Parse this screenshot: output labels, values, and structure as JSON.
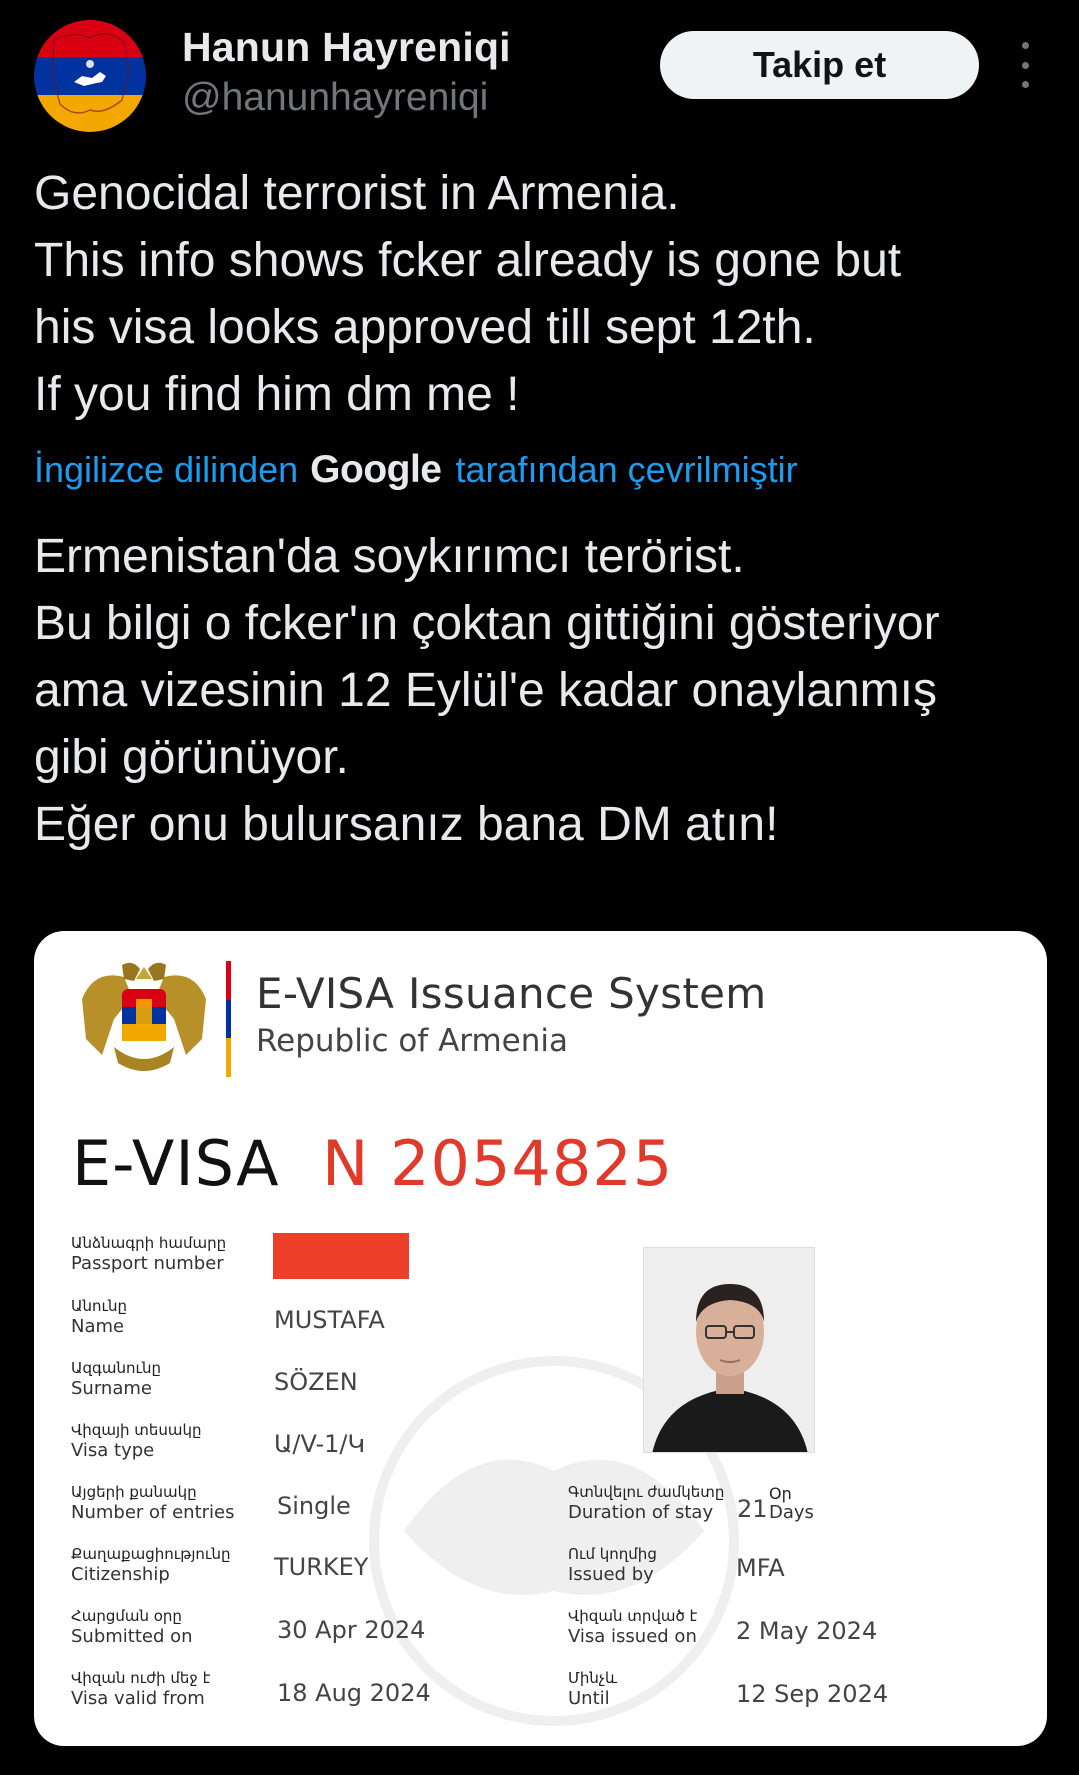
{
  "user": {
    "display_name": "Hanun Hayreniqi",
    "handle": "@hanunhayreniqi",
    "follow_label": "Takip et"
  },
  "tweet": {
    "lines": [
      "Genocidal terrorist in Armenia.",
      "This info shows fcker already is gone but",
      "his visa looks approved till sept 12th.",
      "If you find him dm me !"
    ]
  },
  "translation": {
    "prefix": "İngilizce dilinden",
    "provider": "Google",
    "suffix": "tarafından çevrilmiştir",
    "lines": [
      "Ermenistan'da soykırımcı terörist.",
      "Bu bilgi o fcker'ın çoktan gittiğini gösteriyor",
      "ama vizesinin 12 Eylül'e kadar onaylanmış",
      "gibi görünüyor.",
      "Eğer onu bulursanız bana DM atın!"
    ]
  },
  "document": {
    "system_title": "E-VISA Issuance System",
    "system_subtitle": "Republic of Armenia",
    "visa_label": "E-VISA",
    "visa_number": "N 2054825",
    "fields_left": [
      {
        "arm": "Անձնագրի համարը",
        "en": "Passport number",
        "value": ""
      },
      {
        "arm": "Անունը",
        "en": "Name",
        "value": "MUSTAFA"
      },
      {
        "arm": "Ազգանունը",
        "en": "Surname",
        "value": "SÖZEN"
      },
      {
        "arm": "Վիզայի տեսակը",
        "en": "Visa type",
        "value": "Ա/V-1/Կ"
      },
      {
        "arm": "Այցերի քանակը",
        "en": "Number of entries",
        "value": "Single"
      },
      {
        "arm": "Քաղաքացիությունը",
        "en": "Citizenship",
        "value": "TURKEY"
      },
      {
        "arm": "Հարցման օրը",
        "en": "Submitted on",
        "value": "30 Apr 2024"
      },
      {
        "arm": "Վիզան ուժի մեջ է",
        "en": "Visa valid from",
        "value": "18 Aug 2024"
      }
    ],
    "fields_right": [
      {
        "arm": "Գտնվելու ժամկետը",
        "en": "Duration of stay",
        "value": "21",
        "unit_arm": "Օր",
        "unit_en": "Days"
      },
      {
        "arm": "Ում կողմից",
        "en": "Issued by",
        "value": "MFA"
      },
      {
        "arm": "Վիզան տրված է",
        "en": "Visa issued on",
        "value": "2 May 2024"
      },
      {
        "arm": "Մինչև",
        "en": "Until",
        "value": "12 Sep 2024"
      }
    ],
    "colors": {
      "red": "#e13a2b",
      "redaction": "#ed3e2a"
    }
  }
}
